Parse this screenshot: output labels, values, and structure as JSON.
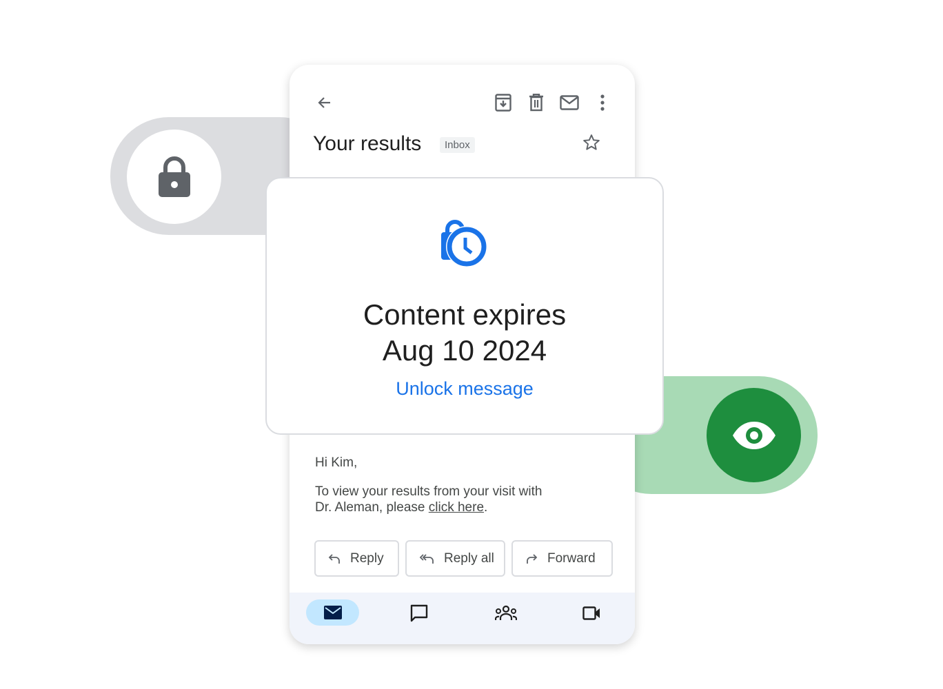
{
  "email": {
    "subject": "Your results",
    "label": "Inbox",
    "greeting": "Hi Kim,",
    "body_text": "To view your results from your visit with Dr. Aleman, please ",
    "link_text": "click here",
    "body_end": ".",
    "actions": [
      {
        "label": "Reply",
        "icon": "reply-icon"
      },
      {
        "label": "Reply all",
        "icon": "reply-all-icon"
      },
      {
        "label": "Forward",
        "icon": "forward-icon"
      }
    ]
  },
  "overlay": {
    "line1": "Content expires",
    "line2": "Aug 10 2024",
    "unlock_label": "Unlock message"
  },
  "nav": {
    "items": [
      "mail",
      "chat",
      "spaces",
      "meet"
    ],
    "active": "mail"
  },
  "colors": {
    "accent": "#1a73e8",
    "green": "#1e8e3e",
    "green_light": "#a8dab5",
    "gray": "#dcdde0"
  }
}
